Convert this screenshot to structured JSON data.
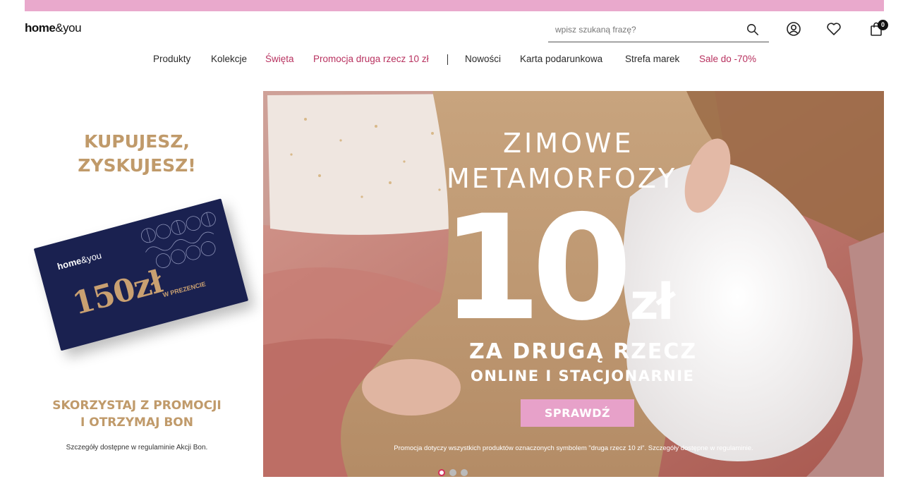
{
  "header": {
    "logo_bold": "home",
    "logo_rest": "&you",
    "search_placeholder": "wpisz szukaną frazę?",
    "cart_count": "0"
  },
  "nav": {
    "items": [
      {
        "label": "Produkty"
      },
      {
        "label": "Kolekcje"
      },
      {
        "label": "Święta"
      },
      {
        "label": "Promocja druga rzecz 10 zł"
      },
      {
        "label": "Nowości"
      },
      {
        "label": "Karta podarunkowa"
      },
      {
        "label": "Strefa marek"
      },
      {
        "label": "Sale do -70%"
      }
    ]
  },
  "left_promo": {
    "title_line1": "KUPUJESZ,",
    "title_line2": "ZYSKUJESZ!",
    "card_logo_bold": "home",
    "card_logo_rest": "&you",
    "card_amount": "150zł",
    "card_sub": "W PREZENCIE",
    "cta_line1": "SKORZYSTAJ Z PROMOCJI",
    "cta_line2": "I OTRZYMAJ BON",
    "details": "Szczegóły dostępne w regulaminie Akcji Bon."
  },
  "hero": {
    "line1": "ZIMOWE",
    "line2": "METAMORFOZY",
    "big_number": "10",
    "currency": "zł",
    "line3": "ZA DRUGĄ RZECZ",
    "line4": "ONLINE I STACJONARNIE",
    "button": "SPRAWDŹ",
    "note": "Promocja dotyczy wszystkich produktów oznaczonych symbolem \"druga rzecz 10 zł\".  Szczegóły dostępne w regulaminie."
  },
  "colors": {
    "topbar": "#e9a9cc",
    "accent_pink": "#b8315f",
    "gold": "#c09a6a",
    "navy": "#1a2150",
    "cta_pink": "#e7a1c9"
  }
}
